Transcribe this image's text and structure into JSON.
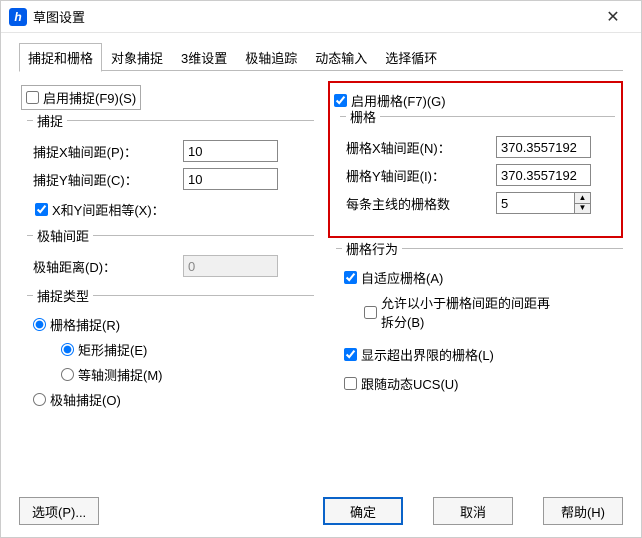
{
  "window": {
    "title": "草图设置"
  },
  "tabs": [
    "捕捉和栅格",
    "对象捕捉",
    "3维设置",
    "极轴追踪",
    "动态输入",
    "选择循环"
  ],
  "active_tab_index": 0,
  "left": {
    "enable_snap": {
      "label": "启用捕捉(F9)(S)",
      "checked": false
    },
    "snap_group": {
      "legend": "捕捉",
      "x_label": "捕捉X轴间距(P)：",
      "x_value": "10",
      "y_label": "捕捉Y轴间距(C)：",
      "y_value": "10",
      "equal_xy": {
        "label": "X和Y间距相等(X)：",
        "checked": true
      }
    },
    "polar_group": {
      "legend": "极轴间距",
      "dist_label": "极轴距离(D)：",
      "dist_value": "0"
    },
    "type_group": {
      "legend": "捕捉类型",
      "grid_snap": {
        "label": "栅格捕捉(R)",
        "checked": true
      },
      "rect_snap": {
        "label": "矩形捕捉(E)",
        "checked": true
      },
      "iso_snap": {
        "label": "等轴测捕捉(M)",
        "checked": false
      },
      "polar_snap": {
        "label": "极轴捕捉(O)",
        "checked": false
      }
    }
  },
  "right": {
    "enable_grid": {
      "label": "启用栅格(F7)(G)",
      "checked": true
    },
    "grid_group": {
      "legend": "栅格",
      "x_label": "栅格X轴间距(N)：",
      "x_value": "370.3557192",
      "y_label": "栅格Y轴间距(I)：",
      "y_value": "370.3557192",
      "major_label": "每条主线的栅格数",
      "major_value": "5"
    },
    "behavior_group": {
      "legend": "栅格行为",
      "adaptive": {
        "label": "自适应栅格(A)",
        "checked": true
      },
      "subdiv": {
        "label": "允许以小于栅格间距的间距再拆分(B)",
        "checked": false
      },
      "beyond": {
        "label": "显示超出界限的栅格(L)",
        "checked": true
      },
      "ucs": {
        "label": "跟随动态UCS(U)",
        "checked": false
      }
    }
  },
  "buttons": {
    "options": "选项(P)...",
    "ok": "确定",
    "cancel": "取消",
    "help": "帮助(H)"
  }
}
